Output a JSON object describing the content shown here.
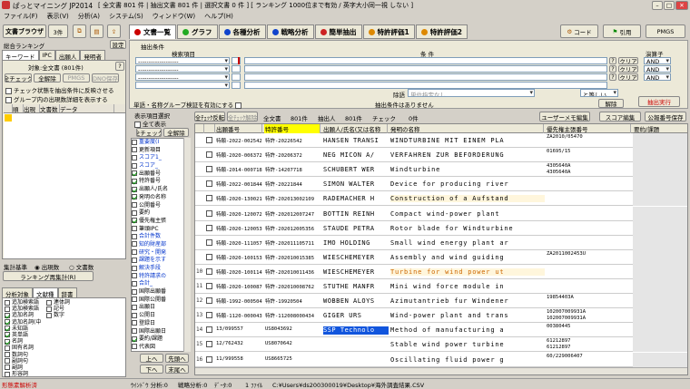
{
  "app": {
    "title": "ぱっとマイニング JP2014",
    "status": "[ 全文書 801 件 | 抽出文書 801 件 | 選択文書 0 件 ] [ ランキング 1000位まで有効 / 英字大小同一視 しない ]"
  },
  "menu": [
    "ファイル(F)",
    "表示(V)",
    "分析(A)",
    "システム(S)",
    "ウィンドウ(W)",
    "ヘルプ(H)"
  ],
  "left": {
    "doc_browser": "文書ブラウザ",
    "count": "3件",
    "settings": "設定",
    "ranking_label": "総合ランキング",
    "tabs": [
      "キーワード",
      "IPC",
      "出願人",
      "発明者"
    ],
    "target": "対象:全文書 (801件)",
    "help": "?",
    "buttons": [
      "全チェック",
      "全解除",
      "PMGS",
      "DNO保存"
    ],
    "opt1": "チェック状態を抽出条件に反映させる",
    "opt2": "グループ内の出現数詳細を表示する",
    "cols": [
      "",
      "順位",
      "出現数",
      "文書数",
      "データ"
    ],
    "basis_label": "集計基準",
    "basis_opt1": "出現数",
    "basis_opt2": "文書数",
    "recalc": "ランキング再集計(R)",
    "tabs2": [
      "分析対象",
      "文献種",
      "辞書"
    ],
    "checks": [
      {
        "l": "追加検索語",
        "c": false
      },
      {
        "l": "追加検索語",
        "c": false
      },
      {
        "l": "追加名詞",
        "c": true
      },
      {
        "l": "追加名詞(中",
        "c": true
      },
      {
        "l": "未知語",
        "c": true
      },
      {
        "l": "英単語",
        "c": true
      },
      {
        "l": "名詞",
        "c": true
      },
      {
        "l": "固有名詞",
        "c": false
      },
      {
        "l": "数詞句",
        "c": false
      },
      {
        "l": "副詞句",
        "c": false
      },
      {
        "l": "副詞",
        "c": false
      },
      {
        "l": "形容詞",
        "c": false
      }
    ],
    "checks_right": [
      {
        "l": "連体詞",
        "c": false
      },
      {
        "l": "記号",
        "c": false
      },
      {
        "l": "数字",
        "c": false
      }
    ]
  },
  "tabs_main": [
    {
      "label": "文書一覧",
      "color": "#cc0000",
      "active": true
    },
    {
      "label": "グラフ",
      "color": "#22aa22"
    },
    {
      "label": "各種分析",
      "color": "#1144cc"
    },
    {
      "label": "戦略分析",
      "color": "#1144cc"
    },
    {
      "label": "簡単抽出",
      "color": "#cc2222"
    },
    {
      "label": "特許評価1",
      "color": "#dd8800"
    },
    {
      "label": "特許評価2",
      "color": "#dd8800"
    }
  ],
  "tools": {
    "code": "コード",
    "cite": "引用",
    "pmgs": "PMGS"
  },
  "cond": {
    "section": "抽出条件",
    "target_header": "検索項目",
    "cond_header": "条 件",
    "andor_header": "演算子",
    "dashes": "-------------------",
    "clear": "クリア",
    "and": "AND",
    "help": "?",
    "row3_label": "除語",
    "row3_placeholder": "単位指定なし",
    "row3_select": "と等しい",
    "release": "解除",
    "exec": "抽出実行",
    "opt_single": "単語・名称グループ検証を有効にする",
    "opt_not": "抽出条件はありません"
  },
  "mid": {
    "title": "表示項目選択",
    "all": "全て表示",
    "btn1": "全チェック",
    "btn2": "全解除",
    "items": [
      {
        "l": "重要度(I",
        "c": false,
        "blue": true
      },
      {
        "l": "更新項目",
        "c": false
      },
      {
        "l": "スコア1_",
        "c": false,
        "blue": true
      },
      {
        "l": "スコア_",
        "c": false,
        "blue": true
      },
      {
        "l": "出願番号",
        "c": true
      },
      {
        "l": "特許番号",
        "c": true
      },
      {
        "l": "出願人/氏名",
        "c": true
      },
      {
        "l": "発明の名称",
        "c": true
      },
      {
        "l": "公開番号",
        "c": false
      },
      {
        "l": "要約",
        "c": false
      },
      {
        "l": "優先権主張",
        "c": true
      },
      {
        "l": "筆頭IPC",
        "c": false
      },
      {
        "l": "合計件数",
        "c": false,
        "blue": true
      },
      {
        "l": "知的財産部",
        "c": false,
        "blue": true
      },
      {
        "l": "研究・開発",
        "c": false,
        "blue": true
      },
      {
        "l": "課題を示す",
        "c": false,
        "blue": true
      },
      {
        "l": "解決手段",
        "c": false,
        "blue": true
      },
      {
        "l": "特許請求の",
        "c": false,
        "blue": true
      },
      {
        "l": "合計_",
        "c": false,
        "blue": true
      },
      {
        "l": "国際出願番",
        "c": false
      },
      {
        "l": "国際公開番",
        "c": false
      },
      {
        "l": "出願日",
        "c": false
      },
      {
        "l": "公開日",
        "c": false
      },
      {
        "l": "登録日",
        "c": false
      },
      {
        "l": "国際出願日",
        "c": false
      },
      {
        "l": "要約/課題",
        "c": true
      },
      {
        "l": "代表図",
        "c": false
      }
    ],
    "up": "上へ",
    "top": "先頭へ",
    "down": "下へ",
    "bottom": "末尾へ"
  },
  "list": {
    "btn_check_flip": "全ﾁｪｯｸ反転",
    "btn_all_uncheck": "全ﾁｪｯｸ解除",
    "total_label": "全文書",
    "total": "801件",
    "extract_label": "抽出人",
    "extract": "801件",
    "check_label": "チェック",
    "check": "0件",
    "btn_memo": "ユーザーメモ編集",
    "btn_score": "スコア編集",
    "btn_pub": "公報番号保存",
    "cols": [
      "",
      "",
      "出願番号",
      "特許番号",
      "出願人/氏名(又は名称",
      "発明の名称",
      "優先権主張番号",
      "要約/課題"
    ],
    "rows": [
      {
        "n": "",
        "a": "特願-2022-002542",
        "p": "特許-20226542",
        "who": "HANSEN TRANSI",
        "title": "WINDTURBINE MIT EINEM PLA",
        "prio": "ZA2010/05470",
        "hl": false
      },
      {
        "n": "",
        "a": "特願-2020-006372",
        "p": "特許-20206372",
        "who": "NEG MICON A/",
        "title": "VERFAHREN ZUR BEFORDERUNG",
        "prio": "01695/15",
        "hl": false
      },
      {
        "n": "",
        "a": "特願-2014-000718",
        "p": "特許-14207718",
        "who": "SCHUBERT WER",
        "title": "Windturbine",
        "prio": "4305640A\n4305640A",
        "hl": false
      },
      {
        "n": "",
        "a": "特願-2022-001844",
        "p": "特許-20221844",
        "who": "SIMON WALTER",
        "title": "Device for producing river",
        "prio": "",
        "hl": false
      },
      {
        "n": "",
        "a": "特願-2020-130021",
        "p": "特許-202013002109",
        "who": "RADEMACHER H",
        "title": "Construction of a Aufstand",
        "prio": "",
        "hl": true
      },
      {
        "n": "",
        "a": "特願-2020-120072",
        "p": "特許-202012007247",
        "who": "BOTTIN REINH",
        "title": "Compact wind-power plant",
        "prio": "",
        "hl": false
      },
      {
        "n": "",
        "a": "特願-2020-120053",
        "p": "特許-202012005356",
        "who": "STAUDE PETRA",
        "title": "Rotor blade for Windturbine",
        "prio": "",
        "hl": false
      },
      {
        "n": "",
        "a": "特願-2020-111057",
        "p": "特許-202011105711",
        "who": "IMO HOLDING",
        "title": "Small wind energy plant ar",
        "prio": "",
        "hl": false
      },
      {
        "n": "",
        "a": "特願-2020-100153",
        "p": "特許-202010015385",
        "who": "WIESCHEMEYER",
        "title": "Assembly and wind guiding",
        "prio": "ZA2011002453U",
        "hl": false
      },
      {
        "n": "10",
        "a": "特願-2020-100114",
        "p": "特許-202010011436",
        "who": "WIESCHEMEYER",
        "title": "Turbine for wind power ut",
        "prio": "",
        "hl": true
      },
      {
        "n": "11",
        "a": "特願-2020-100087",
        "p": "特許-202010008762",
        "who": "STUTHE MANFR",
        "title": "Mini wind force module in",
        "prio": "",
        "hl": false
      },
      {
        "n": "12",
        "a": "特願-1992-000504",
        "p": "特許-19920504",
        "who": "WOBBEN ALOYS",
        "title": "Azimutantrieb fur Windener",
        "prio": "19854403A",
        "hl": false
      },
      {
        "n": "13",
        "a": "特願-1120-000043",
        "p": "特許-112008000434",
        "who": "GIGER URS",
        "title": "Wind-power plant and trans",
        "prio": "102007009931A\n102007009931A",
        "hl": false
      },
      {
        "n": "14",
        "a": "13/099557",
        "p": "US8043692",
        "who": "SSP Technolo",
        "title": "Method of manufacturing a",
        "prio": "00380445",
        "hl": false,
        "sel": true
      },
      {
        "n": "15",
        "a": "12/762432",
        "p": "US8070642",
        "who": "",
        "title": "Stable wind power turbine",
        "prio": "61212897\n61212897",
        "hl": false
      },
      {
        "n": "16",
        "a": "11/999558",
        "p": "US8665725",
        "who": "",
        "title": "Oscillating fluid power g",
        "prio": "60/229006407",
        "hl": false
      }
    ]
  },
  "statusbar": {
    "left": "形態素解析済",
    "s1": "ｳｲﾝﾄﾞｳ 分析:0",
    "s2": "戦略分析:0",
    "s3": "ﾃﾞｰﾀ:0",
    "s4": "1 ﾌｧｲﾙ",
    "path": "C:¥Users¥ds200300019¥Desktop¥海外調査結果.CSV"
  }
}
